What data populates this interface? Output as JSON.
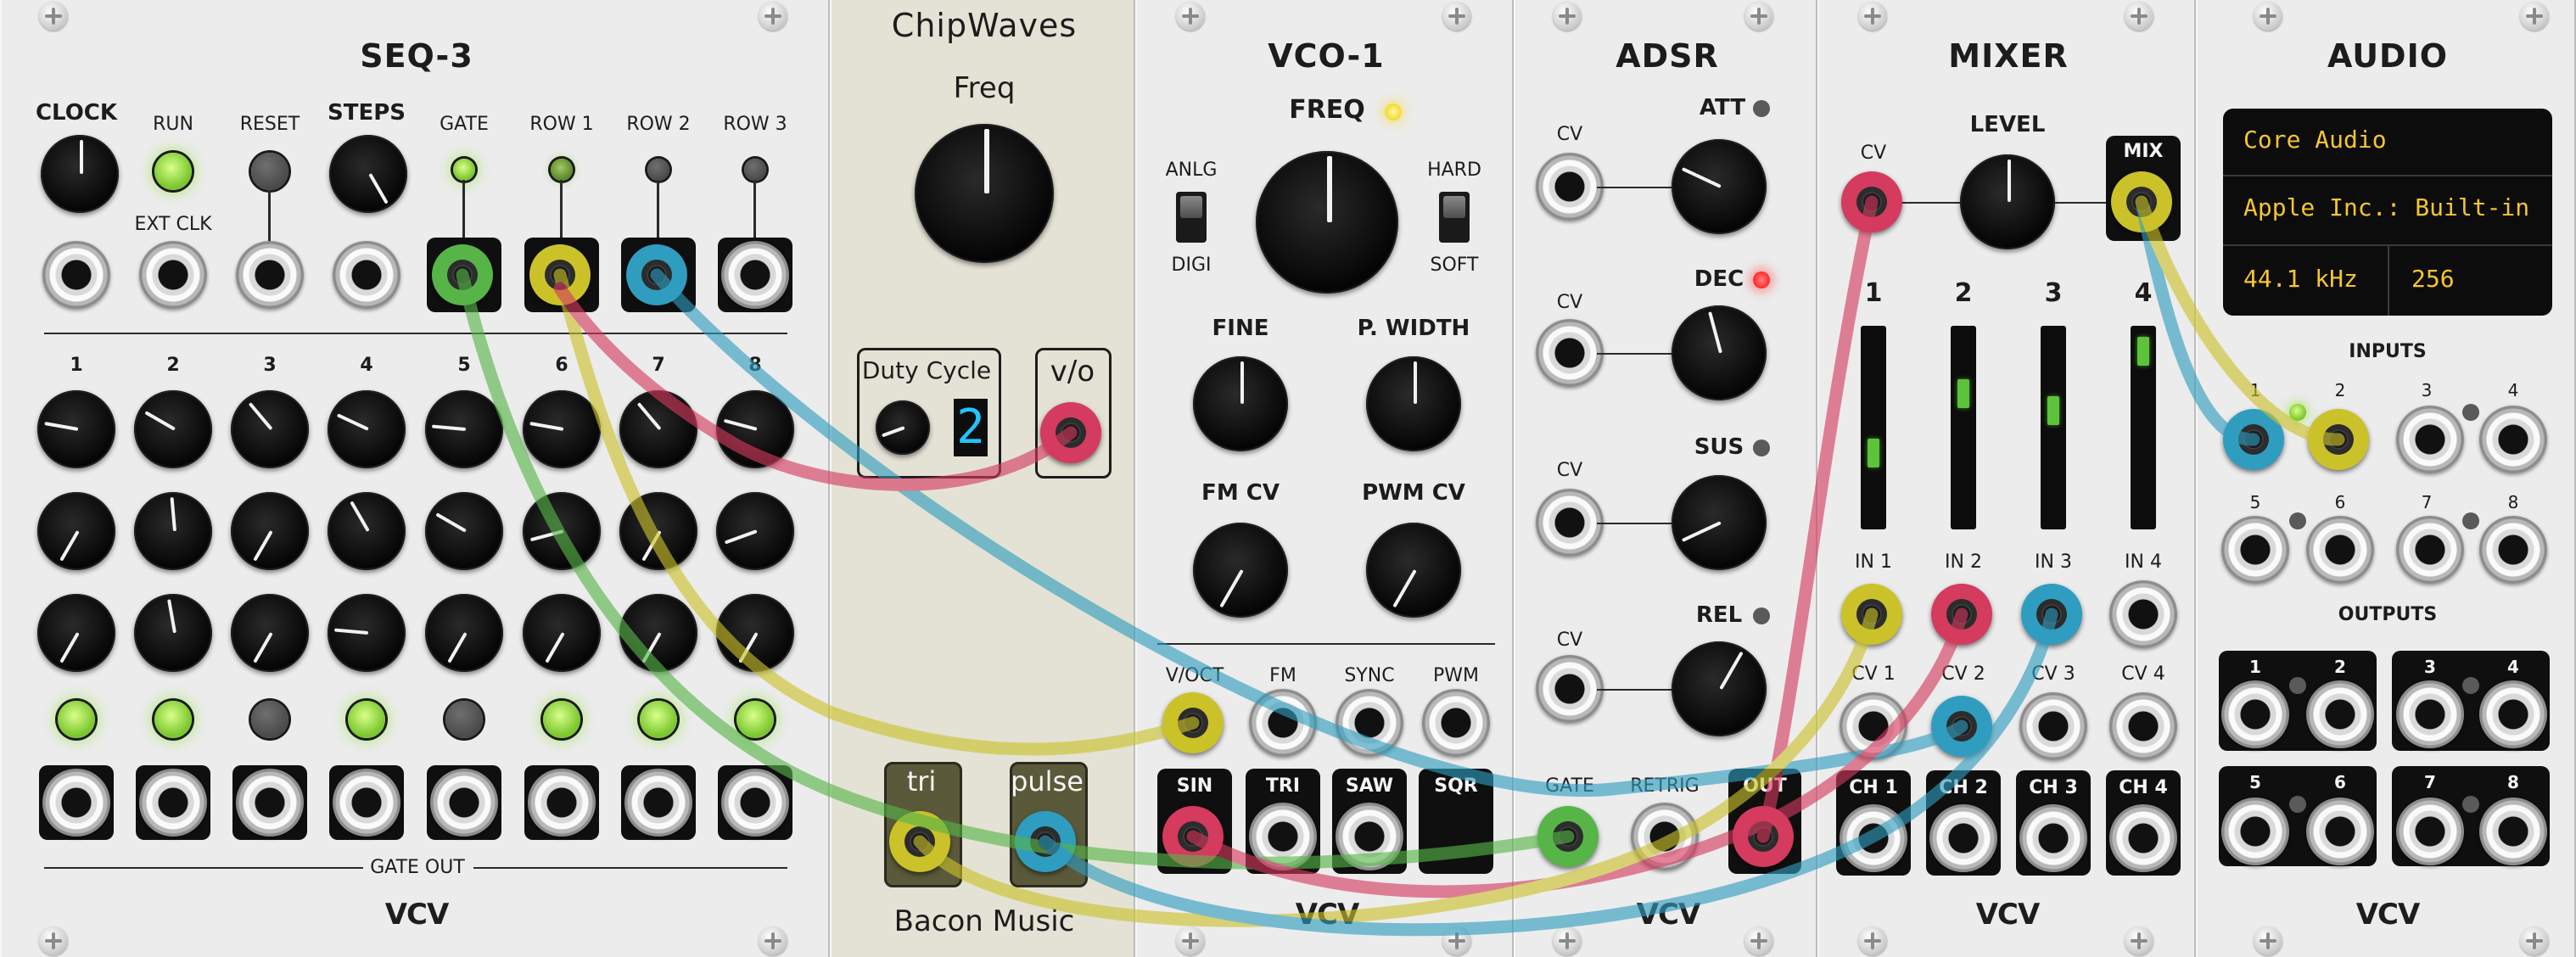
{
  "modules": {
    "seq3": {
      "title": "SEQ-3",
      "labels": {
        "clock": "CLOCK",
        "run": "RUN",
        "reset": "RESET",
        "steps": "STEPS",
        "ext_clk": "EXT CLK",
        "gate": "GATE",
        "row1": "ROW 1",
        "row2": "ROW 2",
        "row3": "ROW 3",
        "gate_out": "GATE OUT"
      },
      "steps": [
        "1",
        "2",
        "3",
        "4",
        "5",
        "6",
        "7",
        "8"
      ],
      "brand": "VCV"
    },
    "chipwaves": {
      "title": "ChipWaves",
      "freq_label": "Freq",
      "duty_label": "Duty Cycle",
      "duty_value": "2",
      "vo_label": "v/o",
      "tri_label": "tri",
      "pulse_label": "pulse",
      "brand": "Bacon Music"
    },
    "vco1": {
      "title": "VCO-1",
      "labels": {
        "freq": "FREQ",
        "anlg": "ANLG",
        "digi": "DIGI",
        "hard": "HARD",
        "soft": "SOFT",
        "fine": "FINE",
        "pwidth": "P. WIDTH",
        "fmcv": "FM CV",
        "pwmcv": "PWM CV",
        "voct": "V/OCT",
        "fm": "FM",
        "sync": "SYNC",
        "pwm": "PWM",
        "sin": "SIN",
        "tri": "TRI",
        "saw": "SAW",
        "sqr": "SQR"
      },
      "brand": "VCV"
    },
    "adsr": {
      "title": "ADSR",
      "labels": {
        "att": "ATT",
        "dec": "DEC",
        "sus": "SUS",
        "rel": "REL",
        "cv": "CV",
        "gate": "GATE",
        "retrig": "RETRIG",
        "out": "OUT"
      },
      "brand": "VCV"
    },
    "mixer": {
      "title": "MIXER",
      "labels": {
        "level": "LEVEL",
        "cv": "CV",
        "mix": "MIX"
      },
      "channels": [
        "1",
        "2",
        "3",
        "4"
      ],
      "fader_levels": [
        0.35,
        0.7,
        0.6,
        0.95
      ],
      "inputs": [
        "IN 1",
        "IN 2",
        "IN 3",
        "IN 4"
      ],
      "cvs": [
        "CV 1",
        "CV 2",
        "CV 3",
        "CV 4"
      ],
      "outs": [
        "CH 1",
        "CH 2",
        "CH 3",
        "CH 4"
      ],
      "brand": "VCV"
    },
    "audio": {
      "title": "AUDIO",
      "screen": {
        "driver": "Core Audio",
        "device": "Apple Inc.: Built-in",
        "rate": "44.1 kHz",
        "block": "256"
      },
      "inputs_label": "INPUTS",
      "outputs_label": "OUTPUTS",
      "ports": [
        "1",
        "2",
        "3",
        "4",
        "5",
        "6",
        "7",
        "8"
      ],
      "brand": "VCV"
    }
  },
  "colors": {
    "cable_green": "#57b548",
    "cable_yellow": "#cbc22a",
    "cable_blue": "#2f9dbf",
    "cable_red": "#d53a5f",
    "led_green": "#8fdc3e"
  }
}
